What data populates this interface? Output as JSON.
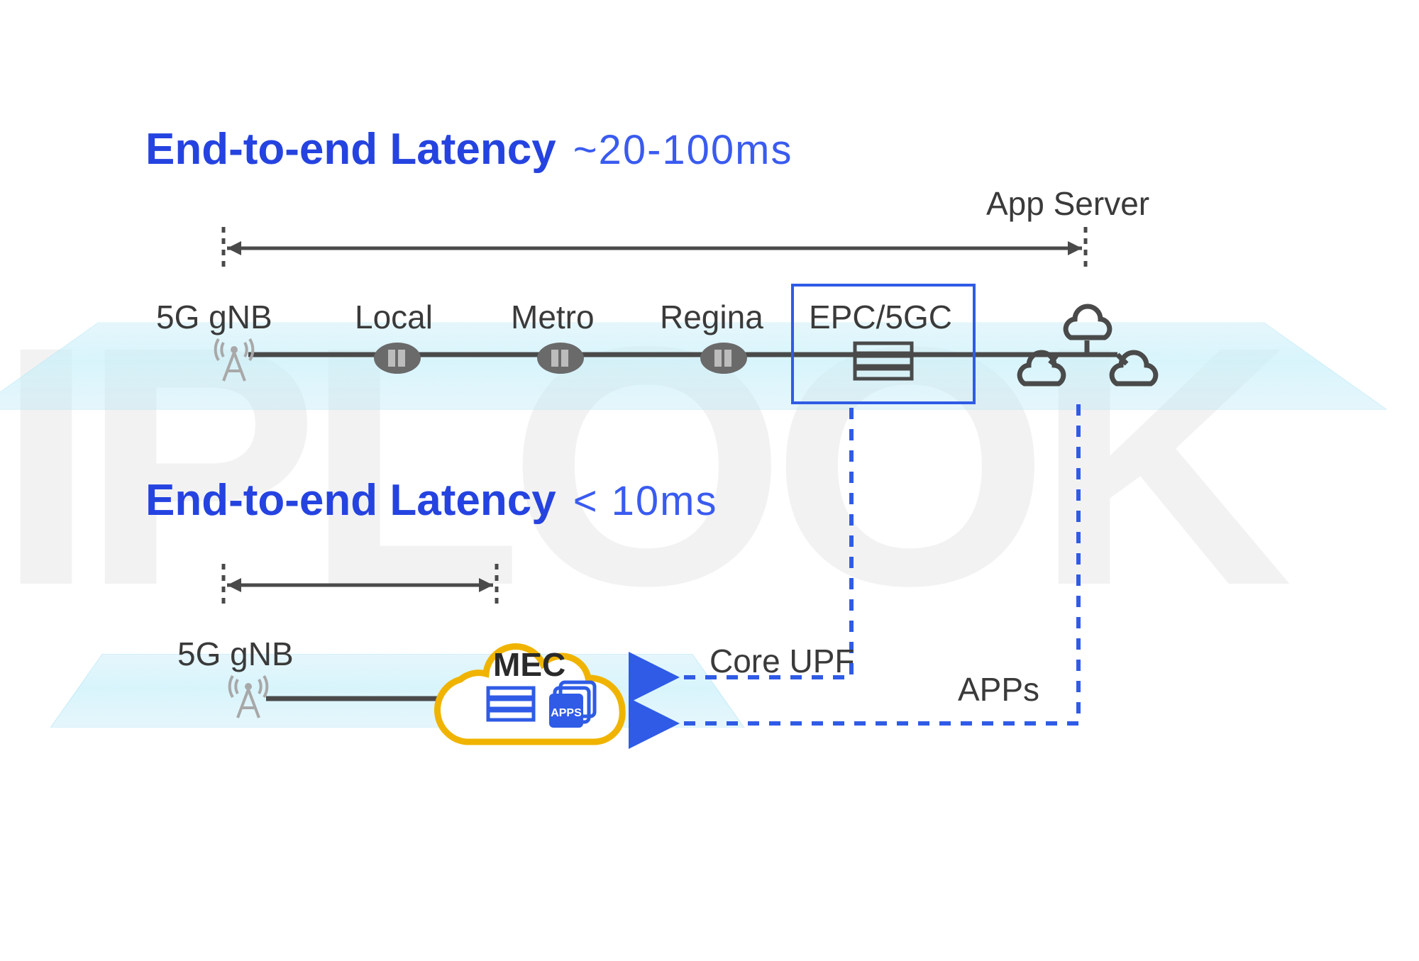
{
  "watermark": "IPLOOK",
  "top": {
    "title_bold": "End-to-end Latency",
    "title_light": "~20-100ms",
    "app_server_label": "App Server",
    "nodes": {
      "gnb": "5G gNB",
      "local": "Local",
      "metro": "Metro",
      "regina": "Regina",
      "epc": "EPC/5GC"
    }
  },
  "bottom": {
    "title_bold": "End-to-end Latency",
    "title_light": "< 10ms",
    "gnb": "5G gNB",
    "mec": "MEC",
    "mec_apps_badge": "APPS"
  },
  "flows": {
    "core_upf": "Core UPF",
    "apps": "APPs"
  },
  "colors": {
    "blue": "#2543e0",
    "gold": "#f0b400",
    "gray": "#4a4a4a",
    "dash_blue": "#2f5be6"
  }
}
